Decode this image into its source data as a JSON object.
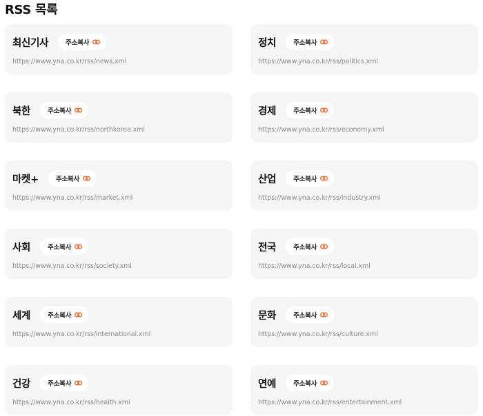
{
  "page_title": "RSS 목록",
  "copy_label": "주소복사",
  "copy_icon": "link-icon",
  "accent_color": "#e8642c",
  "feeds": [
    {
      "name": "최신기사",
      "url": "https://www.yna.co.kr/rss/news.xml"
    },
    {
      "name": "정치",
      "url": "https://www.yna.co.kr/rss/politics.xml"
    },
    {
      "name": "북한",
      "url": "https://www.yna.co.kr/rss/northkorea.xml"
    },
    {
      "name": "경제",
      "url": "https://www.yna.co.kr/rss/economy.xml"
    },
    {
      "name": "마켓+",
      "url": "https://www.yna.co.kr/rss/market.xml"
    },
    {
      "name": "산업",
      "url": "https://www.yna.co.kr/rss/industry.xml"
    },
    {
      "name": "사회",
      "url": "https://www.yna.co.kr/rss/society.xml"
    },
    {
      "name": "전국",
      "url": "https://www.yna.co.kr/rss/local.xml"
    },
    {
      "name": "세계",
      "url": "https://www.yna.co.kr/rss/international.xml"
    },
    {
      "name": "문화",
      "url": "https://www.yna.co.kr/rss/culture.xml"
    },
    {
      "name": "건강",
      "url": "https://www.yna.co.kr/rss/health.xml"
    },
    {
      "name": "연예",
      "url": "https://www.yna.co.kr/rss/entertainment.xml"
    }
  ]
}
